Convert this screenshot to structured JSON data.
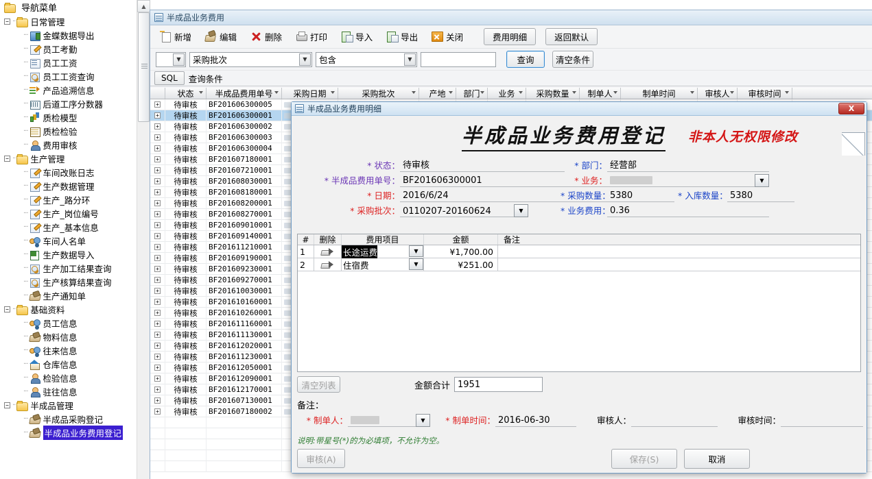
{
  "sidebar": {
    "root_label": "导航菜单",
    "groups": [
      {
        "label": "日常管理",
        "items": [
          {
            "label": "金蝶数据导出",
            "icon": "kingdee-export-icon"
          },
          {
            "label": "员工考勤",
            "icon": "attendance-icon"
          },
          {
            "label": "员工工资",
            "icon": "salary-doc-icon"
          },
          {
            "label": "员工工资查询",
            "icon": "salary-search-icon"
          },
          {
            "label": "产品追溯信息",
            "icon": "trace-icon"
          },
          {
            "label": "后道工序分数器",
            "icon": "counter-icon"
          },
          {
            "label": "质检模型",
            "icon": "chart-bars-icon"
          },
          {
            "label": "质检检验",
            "icon": "grid-icon"
          },
          {
            "label": "费用审核",
            "icon": "person-review-icon"
          }
        ]
      },
      {
        "label": "生产管理",
        "items": [
          {
            "label": "车间改账日志",
            "icon": "attendance-icon"
          },
          {
            "label": "生产数据管理",
            "icon": "edit-pencil-icon"
          },
          {
            "label": "生产_路分环",
            "icon": "edit-pencil-icon"
          },
          {
            "label": "生产_岗位编号",
            "icon": "edit-pencil-icon"
          },
          {
            "label": "生产_基本信息",
            "icon": "edit-pencil-icon"
          },
          {
            "label": "车间人名单",
            "icon": "people-icon"
          },
          {
            "label": "生产数据导入",
            "icon": "excel-import-icon"
          },
          {
            "label": "生产加工结果查询",
            "icon": "search-doc-icon"
          },
          {
            "label": "生产核算结果查询",
            "icon": "search-doc-icon"
          },
          {
            "label": "生产通知单",
            "icon": "stamp-icon"
          }
        ]
      },
      {
        "label": "基础资料",
        "items": [
          {
            "label": "员工信息",
            "icon": "people-icon"
          },
          {
            "label": "物料信息",
            "icon": "stamp-icon"
          },
          {
            "label": "往来信息",
            "icon": "people-icon"
          },
          {
            "label": "仓库信息",
            "icon": "warehouse-icon"
          },
          {
            "label": "检验信息",
            "icon": "person-review-icon"
          },
          {
            "label": "驻往信息",
            "icon": "person-icon"
          }
        ]
      },
      {
        "label": "半成品管理",
        "items": [
          {
            "label": "半成品采购登记",
            "icon": "stamp-icon"
          },
          {
            "label": "半成品业务费用登记",
            "icon": "stamp-icon",
            "selected": true
          }
        ]
      }
    ]
  },
  "window": {
    "title": "半成品业务费用"
  },
  "toolbar": {
    "buttons": [
      {
        "label": "新增",
        "icon": "new-icon"
      },
      {
        "label": "编辑",
        "icon": "edit-icon"
      },
      {
        "label": "删除",
        "icon": "delete-icon"
      },
      {
        "label": "打印",
        "icon": "print-icon"
      },
      {
        "label": "导入",
        "icon": "import-icon"
      },
      {
        "label": "导出",
        "icon": "export-icon"
      },
      {
        "label": "关闭",
        "icon": "close-icon"
      }
    ],
    "detail_button": "费用明细",
    "default_button": "返回默认"
  },
  "filter": {
    "logic_value": "",
    "field_value": "采购批次",
    "operator_value": "包含",
    "keyword_value": "",
    "keyword_placeholder": "",
    "search_button": "查询",
    "clear_button": "清空条件",
    "sql_button": "SQL",
    "condition_label": "查询条件"
  },
  "grid": {
    "columns": [
      "状态",
      "半成品费用单号",
      "采购日期",
      "采购批次",
      "产地",
      "部门",
      "业务",
      "采购数量",
      "制单人",
      "制单时间",
      "审核人",
      "审核时间"
    ],
    "rows": [
      {
        "status": "待审核",
        "no": "BF201606300005"
      },
      {
        "status": "待审核",
        "no": "BF201606300001",
        "selected": true
      },
      {
        "status": "待审核",
        "no": "BF201606300002"
      },
      {
        "status": "待审核",
        "no": "BF201606300003"
      },
      {
        "status": "待审核",
        "no": "BF201606300004"
      },
      {
        "status": "待审核",
        "no": "BF201607180001"
      },
      {
        "status": "待审核",
        "no": "BF201607210001"
      },
      {
        "status": "待审核",
        "no": "BF201608030001"
      },
      {
        "status": "待审核",
        "no": "BF201608180001"
      },
      {
        "status": "待审核",
        "no": "BF201608200001"
      },
      {
        "status": "待审核",
        "no": "BF201608270001"
      },
      {
        "status": "待审核",
        "no": "BF201609010001"
      },
      {
        "status": "待审核",
        "no": "BF201609140001"
      },
      {
        "status": "待审核",
        "no": "BF201611210001"
      },
      {
        "status": "待审核",
        "no": "BF201609190001"
      },
      {
        "status": "待审核",
        "no": "BF201609230001"
      },
      {
        "status": "待审核",
        "no": "BF201609270001"
      },
      {
        "status": "待审核",
        "no": "BF201610030001"
      },
      {
        "status": "待审核",
        "no": "BF201610160001"
      },
      {
        "status": "待审核",
        "no": "BF201610260001"
      },
      {
        "status": "待审核",
        "no": "BF201611160001"
      },
      {
        "status": "待审核",
        "no": "BF201611130001"
      },
      {
        "status": "待审核",
        "no": "BF201612020001"
      },
      {
        "status": "待审核",
        "no": "BF201611230001"
      },
      {
        "status": "待审核",
        "no": "BF201612050001"
      },
      {
        "status": "待审核",
        "no": "BF201612090001"
      },
      {
        "status": "待审核",
        "no": "BF201612170001"
      },
      {
        "status": "待审核",
        "no": "BF201607130001"
      },
      {
        "status": "待审核",
        "no": "BF201607180002"
      }
    ]
  },
  "dialog": {
    "title": "半成品业务费用明细",
    "close_label": "X",
    "banner_title": "半成品业务费用登记",
    "banner_note": "非本人无权限修改",
    "fields": {
      "status_label": "* 状态：",
      "status_value": "待审核",
      "no_label": "* 半成品费用单号：",
      "no_value": "BF201606300001",
      "date_label": "* 日期：",
      "date_value": "2016/6/24",
      "batch_label": "* 采购批次：",
      "batch_value": "0110207-20160624",
      "dept_label": "* 部门：",
      "dept_value": "经营部",
      "business_label": "* 业务：",
      "business_value": "",
      "purchase_qty_label": "* 采购数量：",
      "purchase_qty_value": "5380",
      "instock_qty_label": "* 入库数量：",
      "instock_qty_value": "5380",
      "fee_label": "* 业务费用：",
      "fee_value": "0.36"
    },
    "items": {
      "columns": [
        "#",
        "删除",
        "费用项目",
        "金额",
        "备注"
      ],
      "rows": [
        {
          "idx": "1",
          "item": "长途运费",
          "amount": "¥1,700.00",
          "remark": "",
          "selected": true
        },
        {
          "idx": "2",
          "item": "住宿费",
          "amount": "¥251.00",
          "remark": "",
          "selected": false
        }
      ]
    },
    "clear_list_button": "清空列表",
    "total_label": "金额合计",
    "total_value": "1951",
    "remark_label": "备注：",
    "remark_value": "",
    "maker_label": "* 制单人：",
    "maker_value": "",
    "make_time_label": "* 制单时间：",
    "make_time_value": "2016-06-30",
    "auditor_label": "审核人：",
    "auditor_value": "",
    "audit_time_label": "审核时间：",
    "audit_time_value": "",
    "hint": "说明:带星号(*)的为必填项，不允许为空。",
    "audit_button": "审核(A)",
    "save_button": "保存(S)",
    "cancel_button": "取消"
  },
  "colors": {
    "accent_blue": "#1b44c8",
    "required_red": "#d22222",
    "selection_blue": "#b5d6f0",
    "sidebar_selection": "#3b1fd0",
    "hint_green": "#2f7d32"
  }
}
